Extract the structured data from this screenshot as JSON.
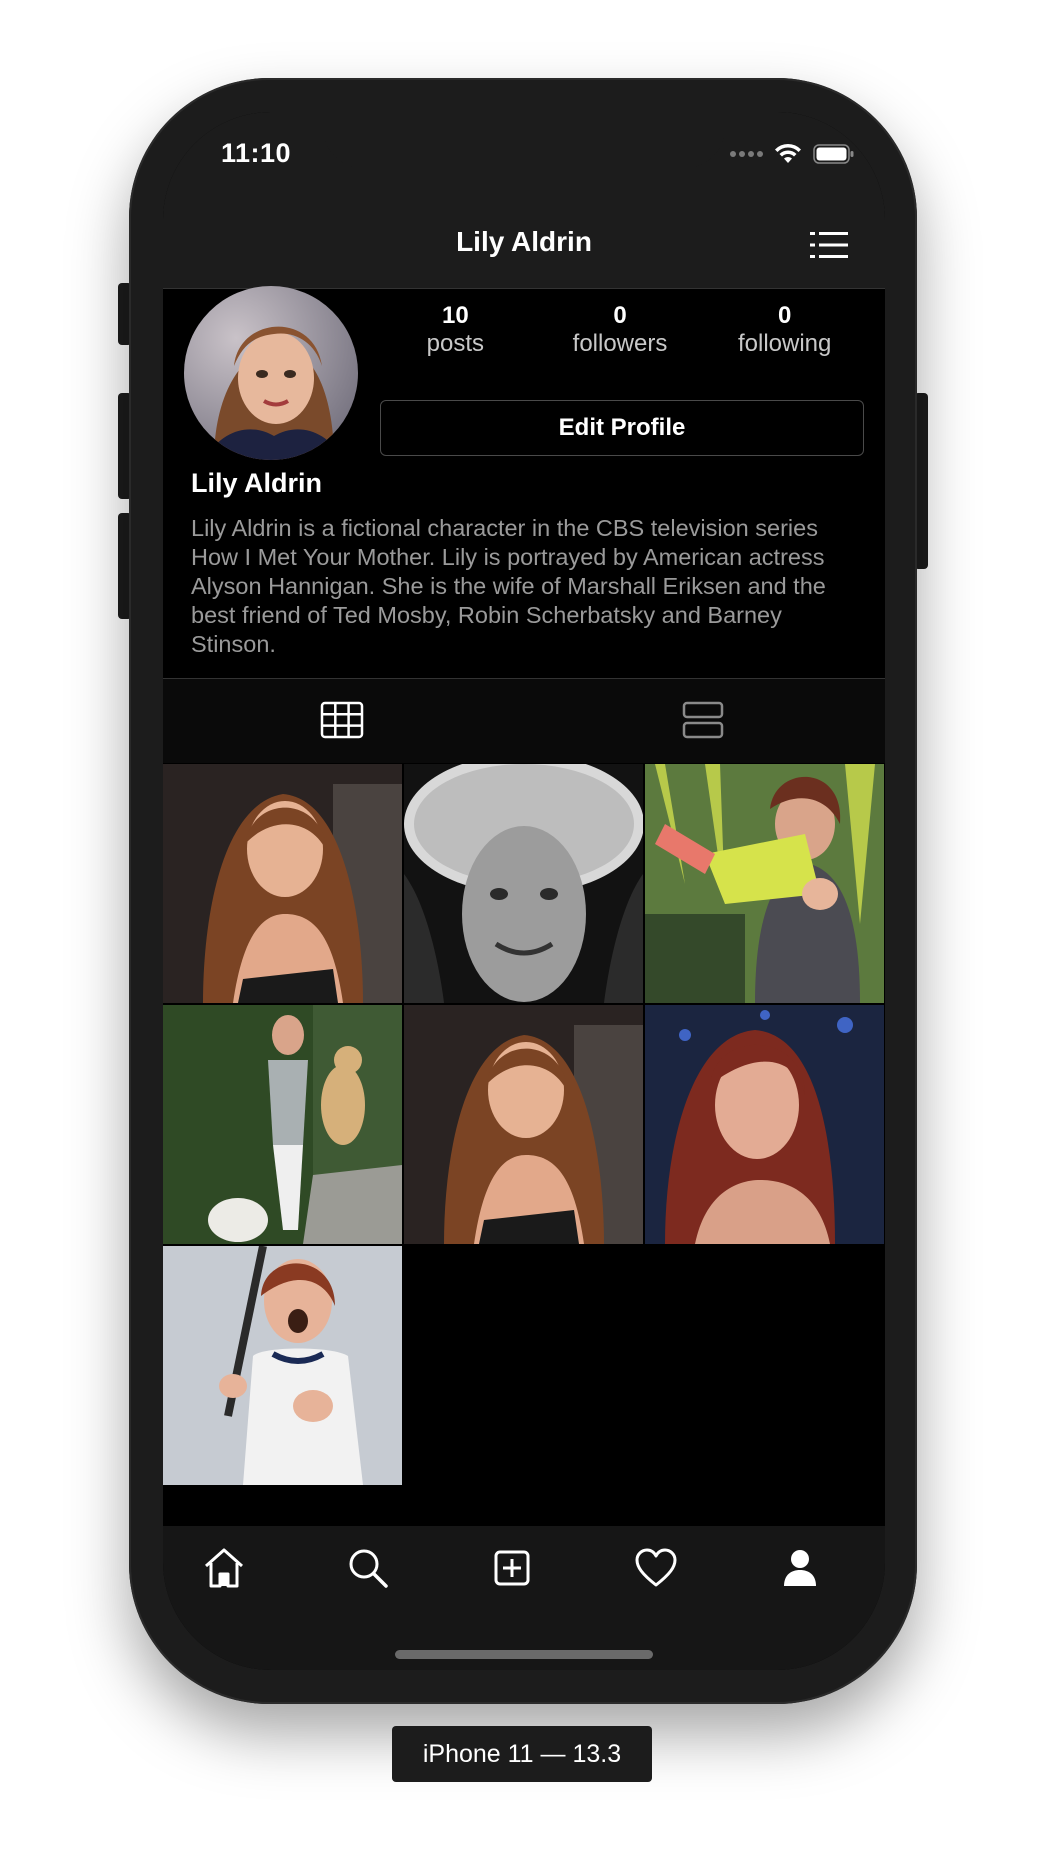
{
  "status_bar": {
    "time": "11:10"
  },
  "header": {
    "title": "Lily Aldrin"
  },
  "profile": {
    "name": "Lily Aldrin",
    "bio": "Lily Aldrin is a fictional character in the CBS television series How I Met Your Mother. Lily is portrayed by American actress Alyson Hannigan. She is the wife of Marshall Eriksen and the best friend of Ted Mosby, Robin Scherbatsky and Barney Stinson.",
    "stats": [
      {
        "value": "10",
        "label": "posts"
      },
      {
        "value": "0",
        "label": "followers"
      },
      {
        "value": "0",
        "label": "following"
      }
    ],
    "edit_button": "Edit Profile"
  },
  "view_tabs": [
    {
      "icon": "grid-icon",
      "active": true
    },
    {
      "icon": "list-icon",
      "active": false
    }
  ],
  "photos": [
    {
      "kind": "portrait-warm"
    },
    {
      "kind": "portrait-bw"
    },
    {
      "kind": "outdoor-child"
    },
    {
      "kind": "outdoor-dog"
    },
    {
      "kind": "portrait-warm"
    },
    {
      "kind": "portrait-redhair"
    },
    {
      "kind": "band-camp"
    }
  ],
  "tab_bar": [
    {
      "icon": "home-icon"
    },
    {
      "icon": "search-icon"
    },
    {
      "icon": "add-post-icon"
    },
    {
      "icon": "heart-icon"
    },
    {
      "icon": "profile-icon",
      "active": true
    }
  ],
  "device_caption": "iPhone 11 — 13.3",
  "colors": {
    "background": "#000000",
    "bar": "#1c1c1c",
    "text_primary": "#ffffff",
    "text_secondary": "#9a9a9a"
  }
}
